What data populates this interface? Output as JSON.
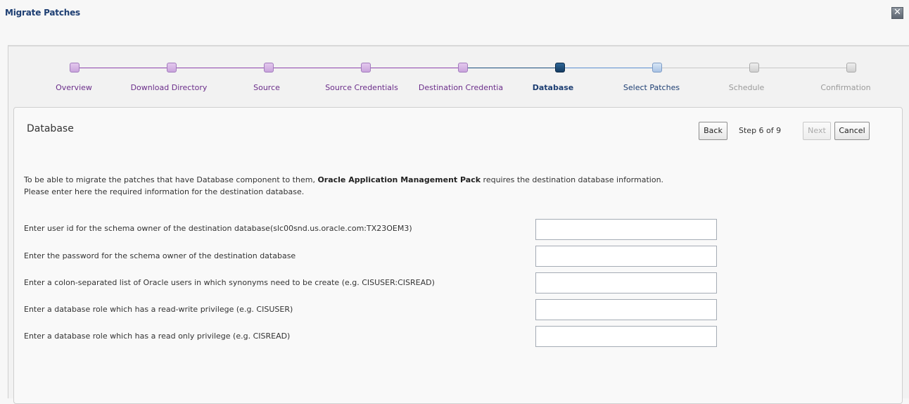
{
  "dialog": {
    "title": "Migrate Patches",
    "close_icon": "close-icon"
  },
  "train": {
    "steps": [
      {
        "label": "Overview",
        "state": "visited"
      },
      {
        "label": "Download Directory",
        "state": "visited"
      },
      {
        "label": "Source",
        "state": "visited"
      },
      {
        "label": "Source Credentials",
        "state": "visited"
      },
      {
        "label": "Destination Credentia",
        "state": "visited"
      },
      {
        "label": "Database",
        "state": "current"
      },
      {
        "label": "Select Patches",
        "state": "next"
      },
      {
        "label": "Schedule",
        "state": "future"
      },
      {
        "label": "Confirmation",
        "state": "future"
      }
    ],
    "colors": {
      "visited": "#8e44ad",
      "current": "#1d4f7e",
      "next": "#5b8fd0",
      "future": "#b0b0b0"
    }
  },
  "panel": {
    "title": "Database",
    "back_label": "Back",
    "step_text": "Step 6 of 9",
    "next_label": "Next",
    "cancel_label": "Cancel"
  },
  "intro": {
    "line1_prefix": "To be able to migrate the patches that have Database component to them, ",
    "line1_bold": "Oracle Application Management Pack",
    "line1_suffix": " requires the destination database information.",
    "line2": "Please enter here the required information for the destination database."
  },
  "fields": [
    {
      "label": "Enter user id for the schema owner of the destination database(slc00snd.us.oracle.com:TX23OEM3)",
      "value": ""
    },
    {
      "label": "Enter the password for the schema owner of the destination database",
      "value": ""
    },
    {
      "label": "Enter a colon-separated list of Oracle users in which synonyms need to be create  (e.g. CISUSER:CISREAD)",
      "value": ""
    },
    {
      "label": "Enter a database role which has a read-write privilege (e.g. CISUSER)",
      "value": ""
    },
    {
      "label": "Enter a database role which has a read only privilege (e.g. CISREAD)",
      "value": ""
    }
  ]
}
